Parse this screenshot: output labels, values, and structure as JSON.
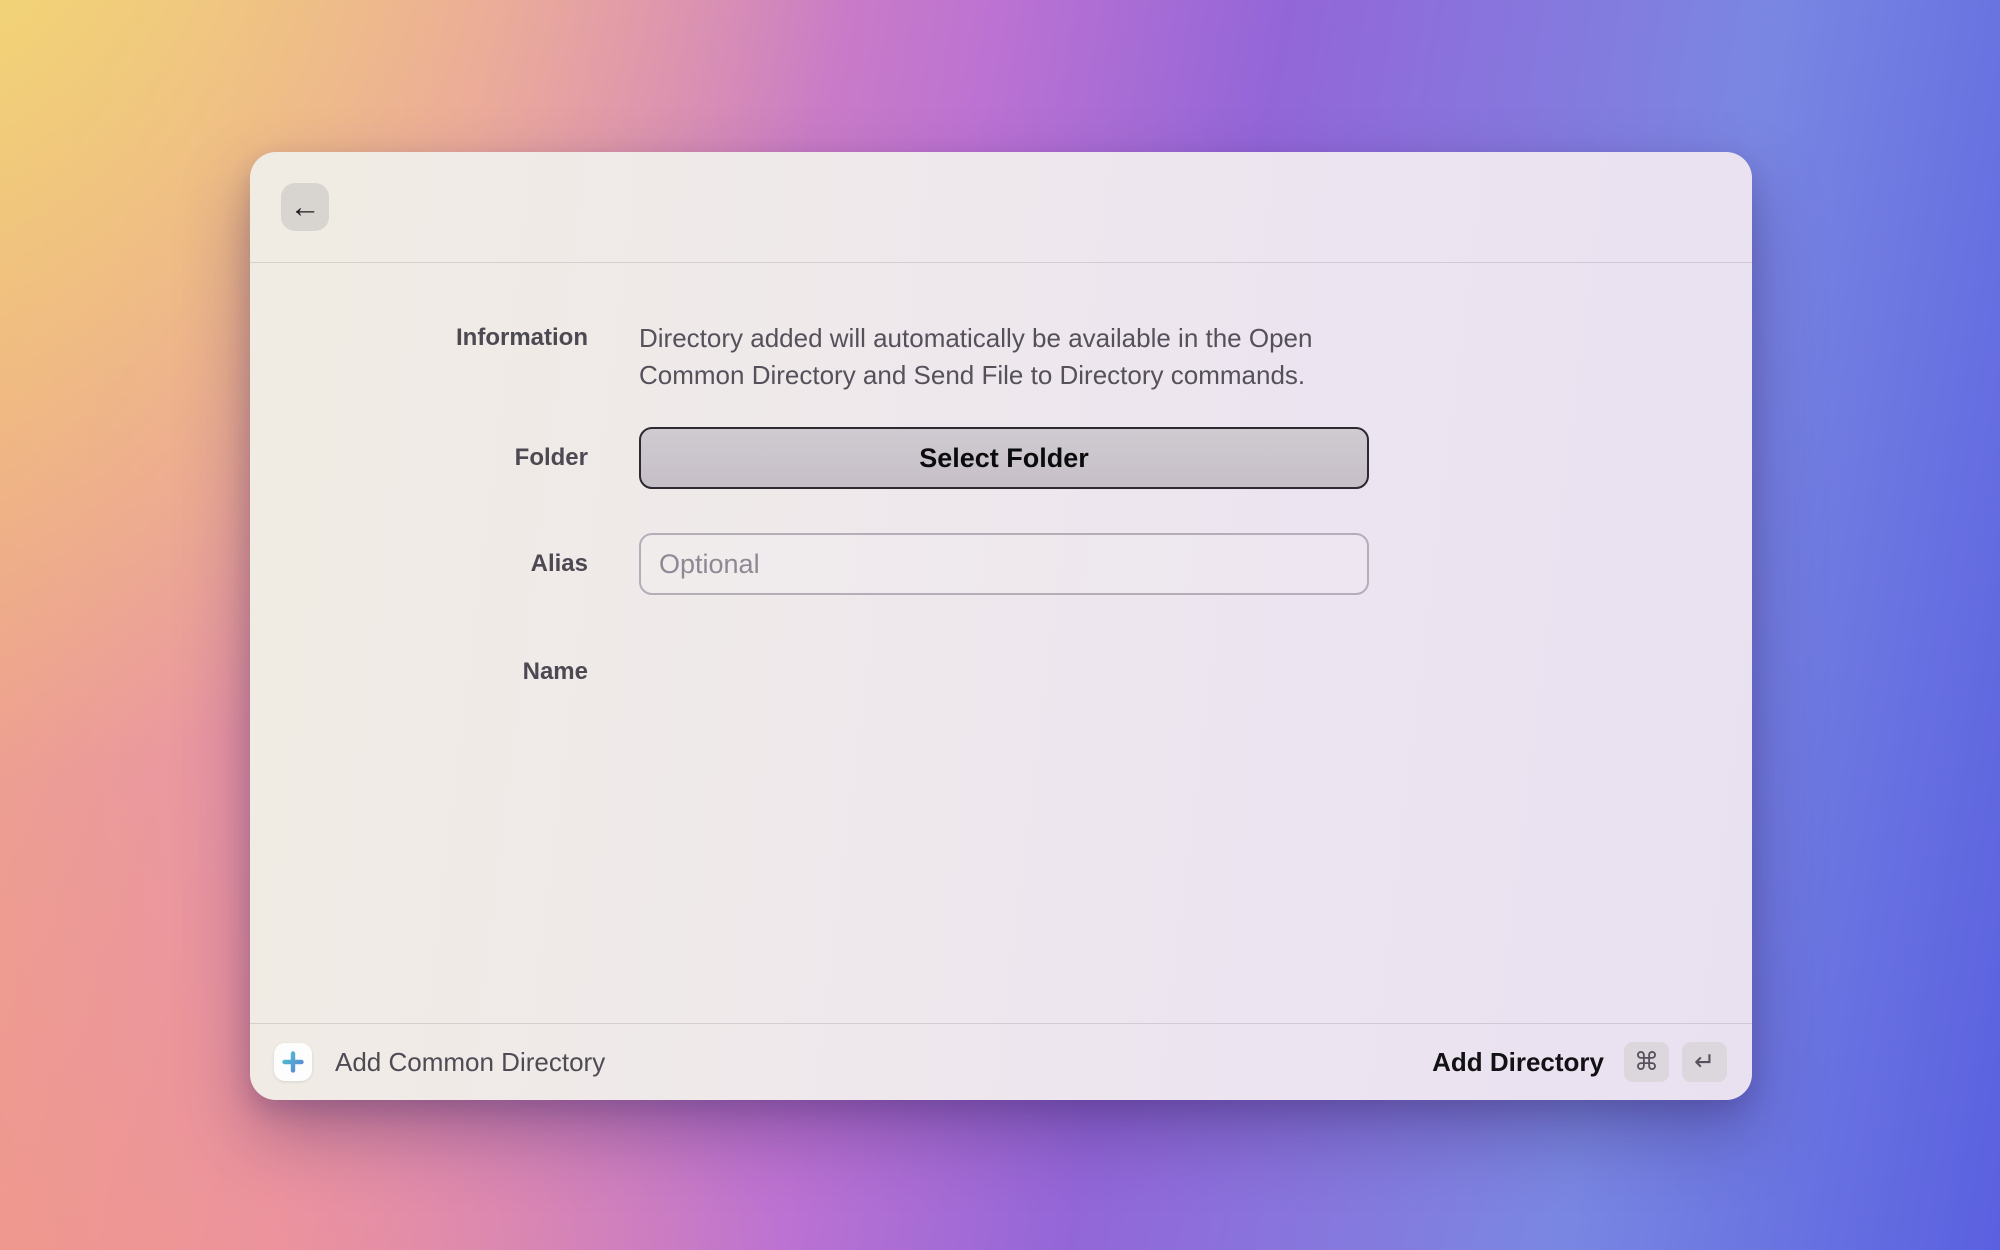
{
  "window": {
    "header": {
      "back_icon": "←"
    },
    "form": {
      "information": {
        "label": "Information",
        "text": "Directory added will automatically be available in the Open Common Directory and Send File to Directory commands."
      },
      "folder": {
        "label": "Folder",
        "button_label": "Select Folder"
      },
      "alias": {
        "label": "Alias",
        "value": "",
        "placeholder": "Optional"
      },
      "name": {
        "label": "Name",
        "value": ""
      }
    },
    "footer": {
      "left_action_label": "Add Common Directory",
      "plus_icon": "plus-icon",
      "primary_action_label": "Add Directory",
      "shortcut_keys": {
        "cmd": "⌘",
        "return": "↵"
      }
    }
  },
  "colors": {
    "plus_gradient_start": "#4cc2cc",
    "plus_gradient_end": "#5d82da",
    "bg_yellow": "#f2dc74",
    "bg_salmon": "#efa487",
    "bg_pink": "#e891ad",
    "bg_purple": "#9366d8",
    "bg_blue": "#5a60e0"
  }
}
